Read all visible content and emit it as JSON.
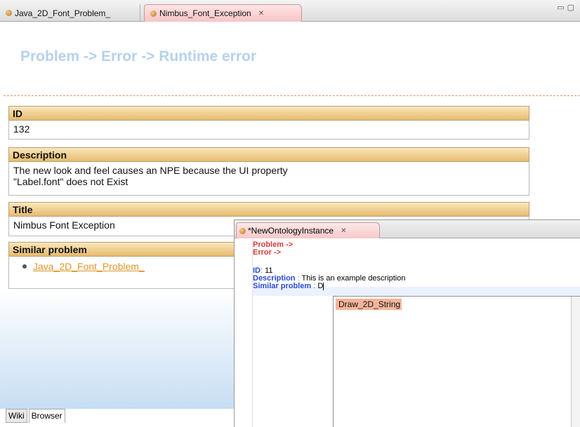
{
  "tabs": [
    {
      "label": "Java_2D_Font_Problem_"
    },
    {
      "label": "Nimbus_Font_Exception"
    }
  ],
  "heading": "Problem -> Error -> Runtime error",
  "sections": {
    "id": {
      "label": "ID",
      "value": "132"
    },
    "description": {
      "label": "Description",
      "line1": "The new look and feel causes an NPE because the UI property",
      "line2": "\"Label.font\" does not Exist"
    },
    "title": {
      "label": "Title",
      "value": "Nimbus Font Exception"
    },
    "similar": {
      "label": "Similar problem",
      "link": "Java_2D_Font_Problem_"
    }
  },
  "bottom_tabs": [
    "Wiki",
    "Browser"
  ],
  "editor": {
    "tab_label": "*NewOntologyInstance",
    "line_problem": "Problem ->",
    "line_error": "Error ->",
    "id_key": "ID",
    "id_sep": ":",
    "id_value": "11",
    "desc_key": "Description",
    "desc_sep": ":",
    "desc_value": "This is an example description",
    "similar_key": "Similar problem",
    "similar_sep": ":",
    "similar_value": "D",
    "suggestion": "Draw_2D_String"
  },
  "colors": {
    "accent": "#e7bb6e",
    "heading": "#b5d2ec",
    "link": "#e0962a"
  },
  "icons": [
    "ontology-instance-icon",
    "close-icon",
    "minimize-icon",
    "maximize-icon"
  ]
}
